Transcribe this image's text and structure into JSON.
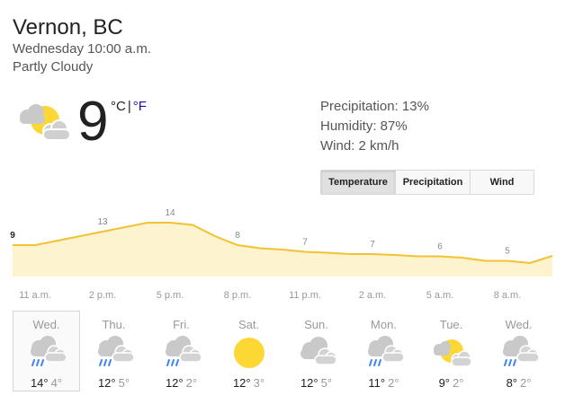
{
  "location": "Vernon, BC",
  "datetime": "Wednesday 10:00 a.m.",
  "condition": "Partly Cloudy",
  "current": {
    "icon": "partly-cloudy-icon",
    "temperature": "9",
    "unit_c": "°C",
    "unit_sep": "|",
    "unit_f": "°F"
  },
  "details": {
    "precipitation": "Precipitation: 13%",
    "humidity": "Humidity: 87%",
    "wind": "Wind: 2 km/h"
  },
  "tabs": [
    {
      "label": "Temperature",
      "active": true
    },
    {
      "label": "Precipitation",
      "active": false
    },
    {
      "label": "Wind",
      "active": false
    }
  ],
  "colors": {
    "chart_line": "#f1c232",
    "chart_fill": "#fdf3cf",
    "sun": "#fdd835",
    "cloud": "#c9c9c9",
    "rain": "#4285f4",
    "link": "#1a0dab"
  },
  "chart_data": {
    "type": "area",
    "x": [
      "10 a.m.",
      "11 a.m.",
      "12 p.m.",
      "1 p.m.",
      "2 p.m.",
      "3 p.m.",
      "4 p.m.",
      "5 p.m.",
      "6 p.m.",
      "7 p.m.",
      "8 p.m.",
      "9 p.m.",
      "10 p.m.",
      "11 p.m.",
      "12 a.m.",
      "1 a.m.",
      "2 a.m.",
      "3 a.m.",
      "4 a.m.",
      "5 a.m.",
      "6 a.m.",
      "7 a.m.",
      "8 a.m.",
      "9 a.m.",
      "10 a.m."
    ],
    "values": [
      9,
      9,
      10,
      11,
      12,
      13,
      14,
      14,
      13.5,
      11,
      9,
      8.3,
      8,
      7.5,
      7.3,
      7,
      7,
      6.8,
      6.5,
      6.5,
      6.2,
      5.5,
      5.5,
      5,
      6.6
    ],
    "labels": [
      {
        "index": 0,
        "text": "9"
      },
      {
        "index": 4,
        "text": "13"
      },
      {
        "index": 7,
        "text": "14"
      },
      {
        "index": 10,
        "text": "8"
      },
      {
        "index": 13,
        "text": "7"
      },
      {
        "index": 16,
        "text": "7"
      },
      {
        "index": 19,
        "text": "6"
      },
      {
        "index": 22,
        "text": "5"
      }
    ],
    "ticks": [
      {
        "index": 1,
        "text": "11 a.m."
      },
      {
        "index": 4,
        "text": "2 p.m."
      },
      {
        "index": 7,
        "text": "5 p.m."
      },
      {
        "index": 10,
        "text": "8 p.m."
      },
      {
        "index": 13,
        "text": "11 p.m."
      },
      {
        "index": 16,
        "text": "2 a.m."
      },
      {
        "index": 19,
        "text": "5 a.m."
      },
      {
        "index": 22,
        "text": "8 a.m."
      }
    ]
  },
  "forecast": [
    {
      "day": "Wed.",
      "icon": "rain-cloud-icon",
      "high": "14°",
      "low": "4°",
      "selected": true
    },
    {
      "day": "Thu.",
      "icon": "rain-cloud-icon",
      "high": "12°",
      "low": "5°",
      "selected": false
    },
    {
      "day": "Fri.",
      "icon": "rain-cloud-icon",
      "high": "12°",
      "low": "2°",
      "selected": false
    },
    {
      "day": "Sat.",
      "icon": "sun-icon",
      "high": "12°",
      "low": "3°",
      "selected": false
    },
    {
      "day": "Sun.",
      "icon": "cloud-icon",
      "high": "12°",
      "low": "5°",
      "selected": false
    },
    {
      "day": "Mon.",
      "icon": "rain-cloud-icon",
      "high": "11°",
      "low": "2°",
      "selected": false
    },
    {
      "day": "Tue.",
      "icon": "partly-cloudy-icon",
      "high": "9°",
      "low": "2°",
      "selected": false
    },
    {
      "day": "Wed.",
      "icon": "rain-cloud-icon",
      "high": "8°",
      "low": "2°",
      "selected": false
    }
  ]
}
